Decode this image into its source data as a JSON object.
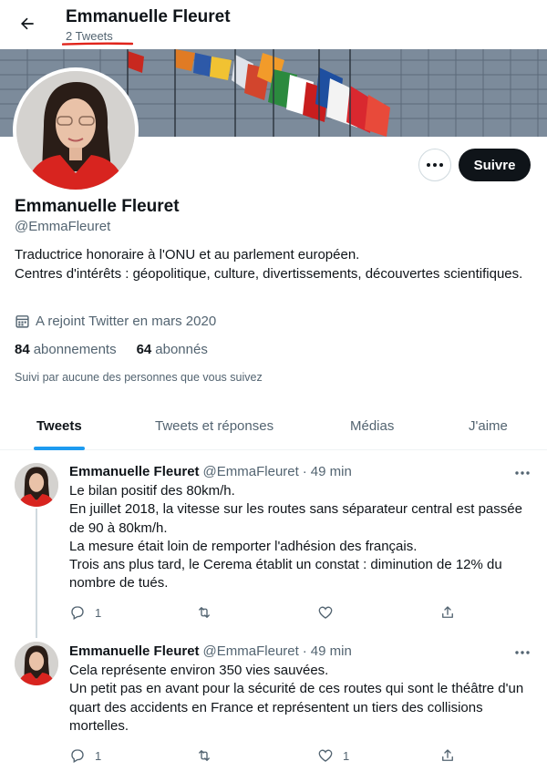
{
  "header": {
    "title": "Emmanuelle Fleuret",
    "tweet_count": "2 Tweets",
    "back_icon": "arrow-left-icon",
    "underline_color": "#e0241b"
  },
  "profile": {
    "name": "Emmanuelle Fleuret",
    "handle": "@EmmaFleuret",
    "bio_line1": "Traductrice honoraire à l'ONU et au parlement européen.",
    "bio_line2": "Centres d'intérêts : géopolitique, culture, divertissements, découvertes scientifiques.",
    "joined": "A rejoint Twitter en mars 2020",
    "following_count": "84",
    "following_label": "abonnements",
    "followers_count": "64",
    "followers_label": "abonnés",
    "followed_by": "Suivi par aucune des personnes que vous suivez",
    "follow_label": "Suivre"
  },
  "tabs": [
    {
      "label": "Tweets",
      "active": true
    },
    {
      "label": "Tweets et réponses",
      "active": false
    },
    {
      "label": "Médias",
      "active": false
    },
    {
      "label": "J'aime",
      "active": false
    }
  ],
  "tweets": [
    {
      "name": "Emmanuelle Fleuret",
      "handle": "@EmmaFleuret",
      "sep": "·",
      "time": "49 min",
      "lines": [
        "Le bilan positif des 80km/h.",
        "En juillet 2018, la vitesse sur les routes sans séparateur central est passée de 90 à 80km/h.",
        "La mesure était loin de remporter l'adhésion des français.",
        "Trois ans plus tard, le Cerema établit un constat : diminution de 12% du nombre de tués."
      ],
      "replies": "1",
      "retweets": "",
      "likes": ""
    },
    {
      "name": "Emmanuelle Fleuret",
      "handle": "@EmmaFleuret",
      "sep": "·",
      "time": "49 min",
      "lines": [
        "Cela représente environ 350 vies sauvées.",
        "Un petit pas en avant pour la sécurité de ces routes qui sont le théâtre d'un quart des accidents en France et représentent un tiers des collisions mortelles."
      ],
      "replies": "1",
      "retweets": "",
      "likes": "1"
    }
  ],
  "colors": {
    "accent": "#1d9bf0",
    "text": "#0f1419",
    "muted": "#536471",
    "follow_bg": "#0f1419"
  }
}
